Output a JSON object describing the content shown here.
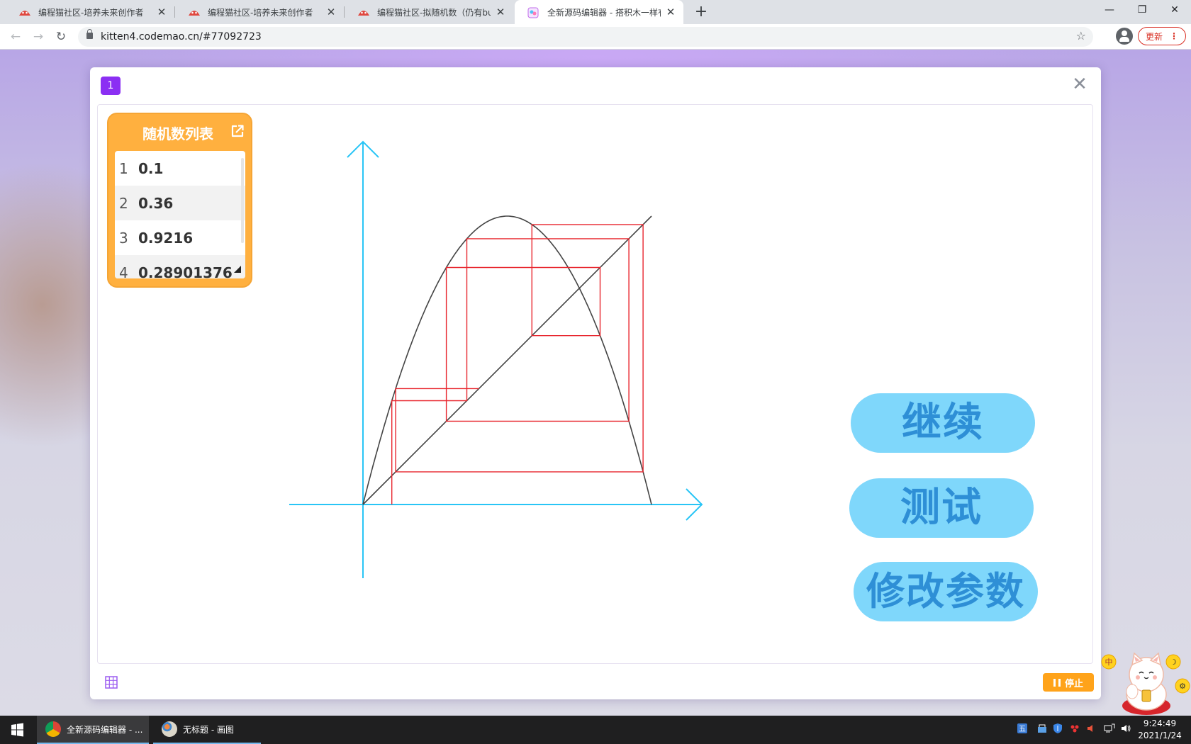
{
  "browser": {
    "tabs": [
      {
        "title": "编程猫社区-培养未来创作者",
        "active": false
      },
      {
        "title": "编程猫社区-培养未来创作者",
        "active": false
      },
      {
        "title": "编程猫社区-拟随机数（仍有bug",
        "active": false
      },
      {
        "title": "全新源码编辑器 - 搭积木一样有",
        "active": true
      }
    ],
    "tab_close_glyph": "✕",
    "new_tab_glyph": "+",
    "url": "kitten4.codemao.cn/#77092723",
    "update_label": "更新",
    "window_controls": [
      "—",
      "❐",
      "✕"
    ]
  },
  "stage": {
    "number_badge": "1",
    "close_glyph": "✕",
    "list_monitor": {
      "title": "随机数列表",
      "items": [
        {
          "index": "1",
          "value": "0.1"
        },
        {
          "index": "2",
          "value": "0.36"
        },
        {
          "index": "3",
          "value": "0.9216"
        },
        {
          "index": "4",
          "value": "0.28901376"
        }
      ]
    },
    "buttons": {
      "continue": "继续",
      "test": "测试",
      "modify": "修改参数"
    },
    "stop_label": "停止"
  },
  "chart_data": {
    "type": "line",
    "title": "",
    "xlabel": "",
    "ylabel": "",
    "xlim": [
      0,
      1
    ],
    "ylim": [
      0,
      1
    ],
    "series": [
      {
        "kind": "curve",
        "formula": "y = 4x(1-x)",
        "color": "#444444"
      },
      {
        "kind": "diagonal",
        "formula": "y = x",
        "color": "#444444"
      },
      {
        "kind": "cobweb",
        "color": "#e8262e",
        "start": 0.1,
        "orbit": [
          0.1,
          0.36,
          0.9216,
          0.28901376,
          0.8219392261,
          0.5854205387,
          0.9708133262,
          0.1133392473,
          0.4019738493
        ]
      }
    ],
    "axis_color": "#29c5f6"
  },
  "taskbar": {
    "items": [
      {
        "label": "全新源码编辑器 - ...",
        "active": true
      },
      {
        "label": "无标题 - 画图",
        "active": false
      }
    ],
    "time": "9:24:49",
    "date": "2021/1/24"
  },
  "mascot": {
    "badges": [
      "中",
      "☽",
      "⚙"
    ]
  }
}
